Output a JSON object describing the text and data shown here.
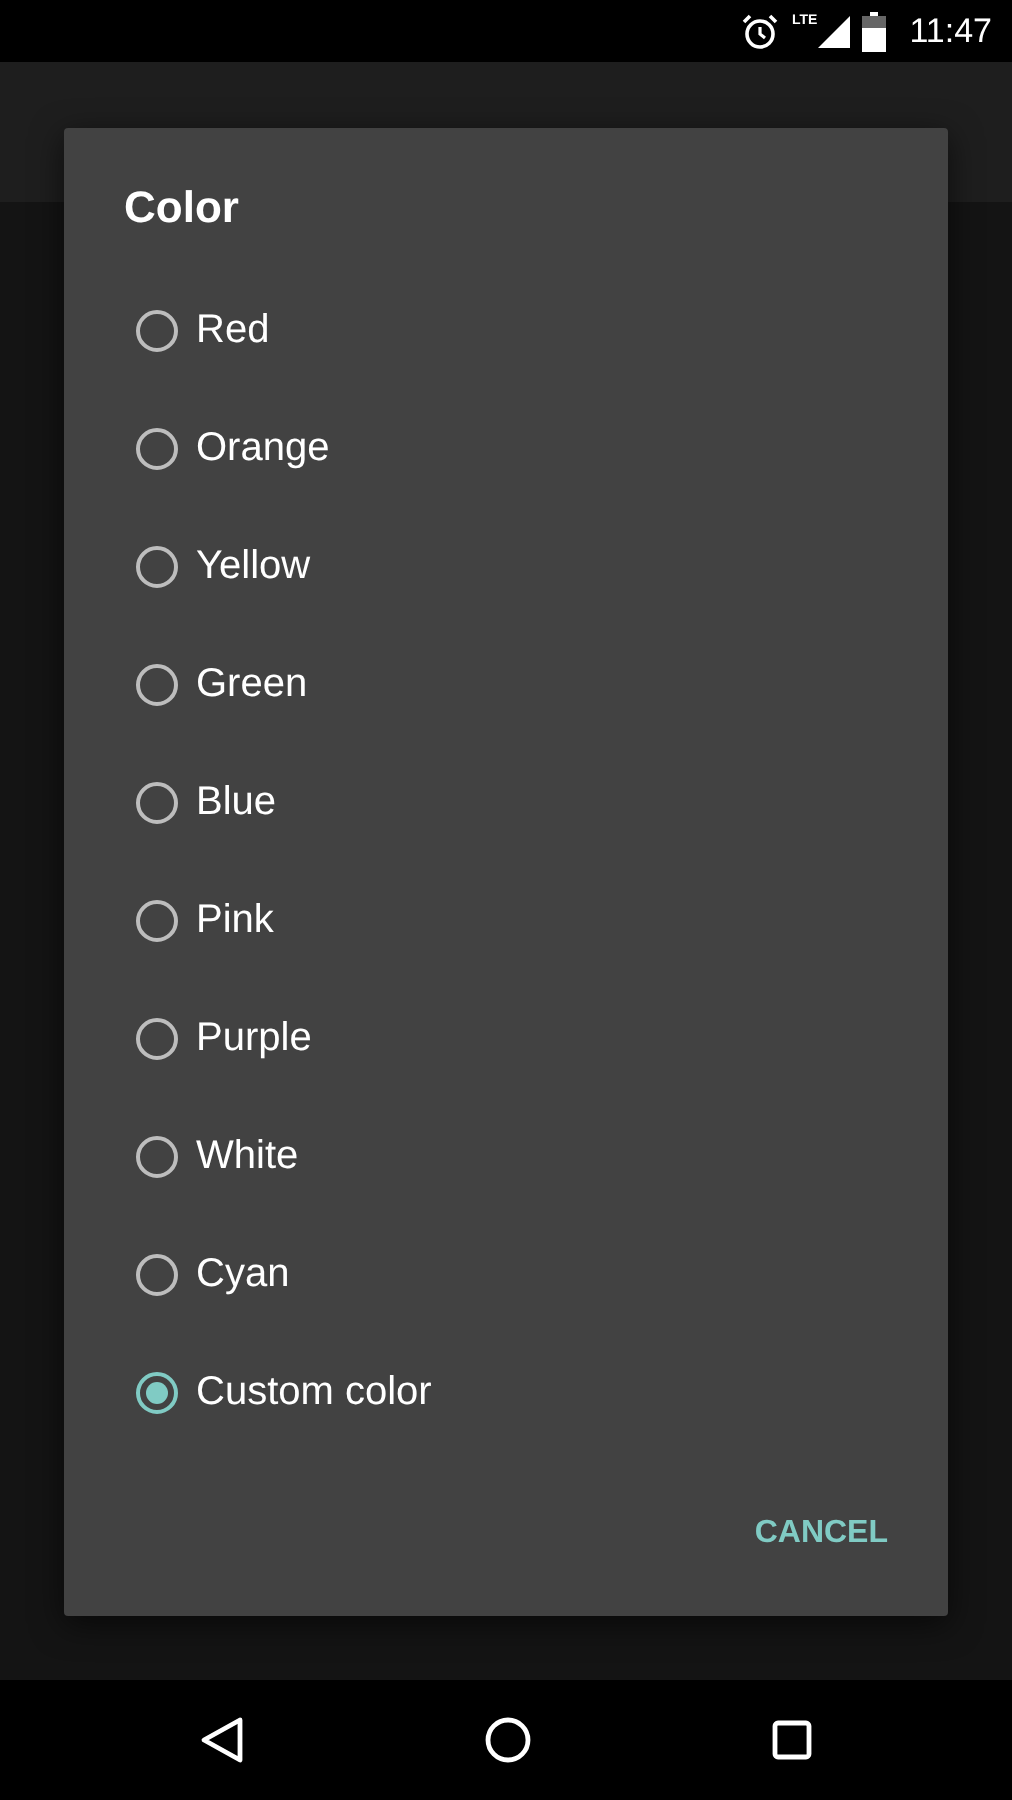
{
  "status_bar": {
    "time": "11:47",
    "network": "LTE"
  },
  "dialog": {
    "title": "Color",
    "options": [
      {
        "label": "Red",
        "selected": false
      },
      {
        "label": "Orange",
        "selected": false
      },
      {
        "label": "Yellow",
        "selected": false
      },
      {
        "label": "Green",
        "selected": false
      },
      {
        "label": "Blue",
        "selected": false
      },
      {
        "label": "Pink",
        "selected": false
      },
      {
        "label": "Purple",
        "selected": false
      },
      {
        "label": "White",
        "selected": false
      },
      {
        "label": "Cyan",
        "selected": false
      },
      {
        "label": "Custom color",
        "selected": true
      }
    ],
    "buttons": [
      "CANCEL"
    ]
  }
}
